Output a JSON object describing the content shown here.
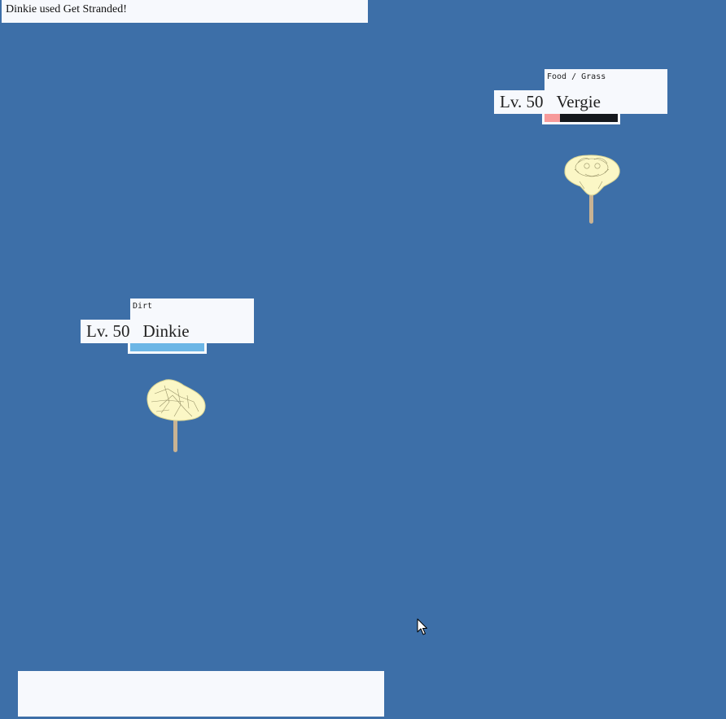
{
  "message": "Dinkie used Get Stranded!",
  "opponent": {
    "types": "Food / Grass",
    "level": "Lv. 50",
    "name": "Vergie",
    "hp_fraction": 0.21,
    "hp_color": "#f79a9a",
    "sprite_icon": "mushroom-creature-icon"
  },
  "player": {
    "types": "Dirt",
    "level": "Lv. 50",
    "name": "Dinkie",
    "hp_fraction": 1.0,
    "hp_color": "#6cb6e6",
    "sprite_icon": "rock-creature-icon"
  },
  "command_input": {
    "value": ""
  },
  "colors": {
    "background": "#3d6fa8",
    "panel": "#f7f9fd",
    "hp_track": "#15181d"
  }
}
